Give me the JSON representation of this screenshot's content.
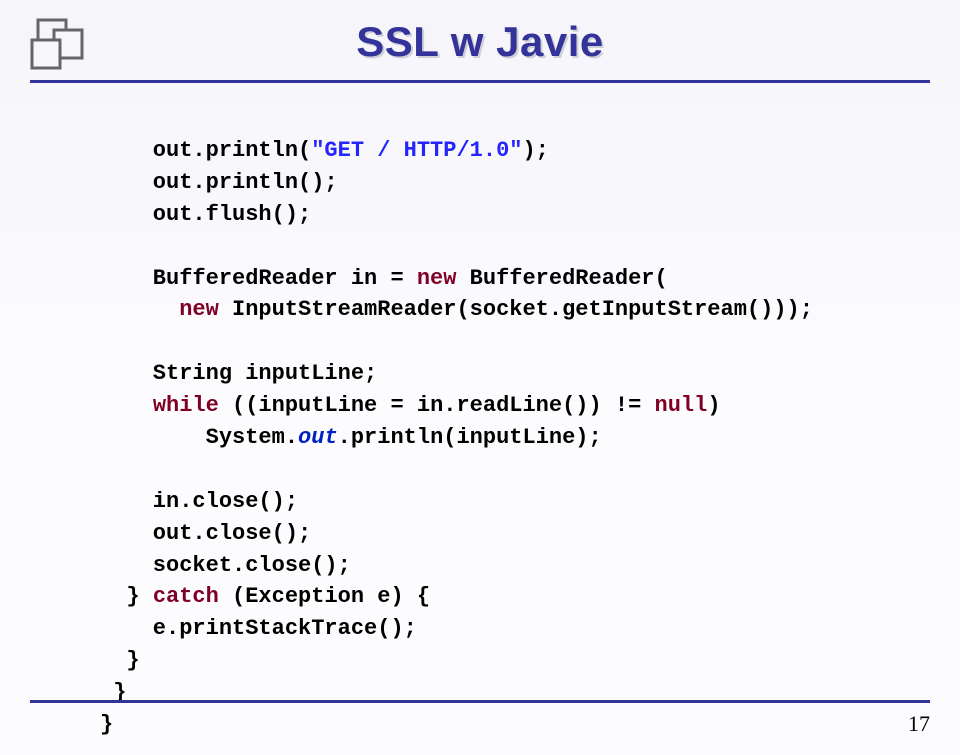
{
  "title": "SSL w Javie",
  "code": {
    "l1_a": "    out.println(",
    "l1_b": "\"GET / HTTP/1.0\"",
    "l1_c": ");",
    "l2": "    out.println();",
    "l3": "    out.flush();",
    "l4_a": "    BufferedReader in = ",
    "l4_b_kw": "new",
    "l4_c": " BufferedReader(",
    "l5_a_kw": "new",
    "l5_b": " InputStreamReader(socket.getInputStream()));",
    "l6": "    String inputLine;",
    "l7_a_kw": "while",
    "l7_b": " ((inputLine = in.readLine()) != ",
    "l7_c_kw": "null",
    "l7_d": ")",
    "l8_a": "        System.",
    "l8_b_fld": "out",
    "l8_c": ".println(inputLine);",
    "l9": "    in.close();",
    "l10": "    out.close();",
    "l11": "    socket.close();",
    "l12_a": "  } ",
    "l12_b_kw": "catch",
    "l12_c": " (Exception e) {",
    "l13": "    e.printStackTrace();",
    "l14": "  }",
    "l15": " }",
    "l16": "}"
  },
  "page_number": "17"
}
